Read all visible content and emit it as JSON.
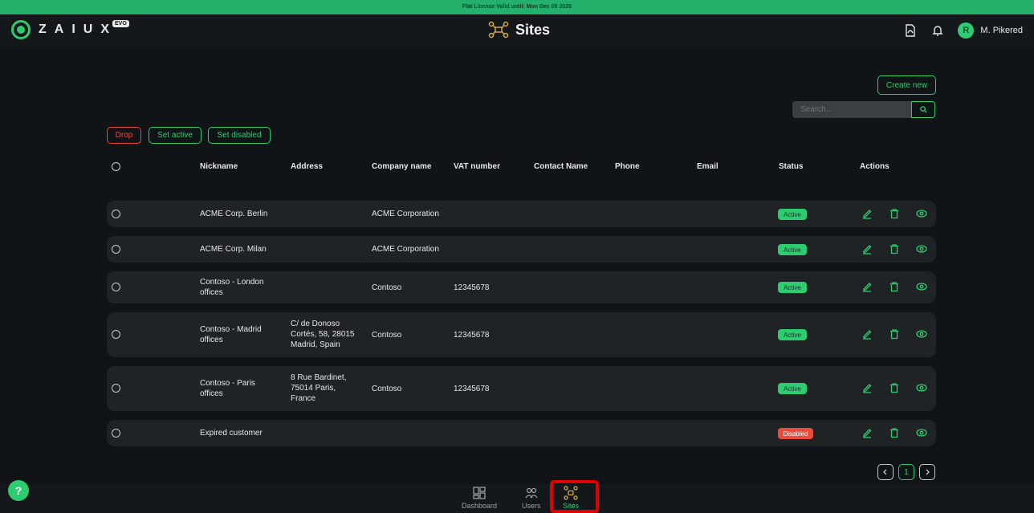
{
  "license": {
    "text": "Flat License   Valid until: Mon Dec 08 2025"
  },
  "app": {
    "logo_text": "ZAIUX",
    "logo_badge": "EVO",
    "page_title": "Sites"
  },
  "user": {
    "initial": "R",
    "name": "M. Pikered"
  },
  "toolbar": {
    "create_label": "Create new",
    "search_placeholder": "Search..."
  },
  "bulk_actions": {
    "drop": "Drop",
    "set_active": "Set active",
    "set_disabled": "Set disabled"
  },
  "columns": [
    "Nickname",
    "Address",
    "Company name",
    "VAT number",
    "Contact Name",
    "Phone",
    "Email",
    "Status",
    "Actions"
  ],
  "rows": [
    {
      "nickname": [
        "ACME Corp. Berlin"
      ],
      "address": [],
      "company": "ACME Corporation",
      "vat": "",
      "status": "Active"
    },
    {
      "nickname": [
        "ACME Corp. Milan"
      ],
      "address": [],
      "company": "ACME Corporation",
      "vat": "",
      "status": "Active"
    },
    {
      "nickname": [
        "Contoso - London",
        "offices"
      ],
      "address": [],
      "company": "Contoso",
      "vat": "12345678",
      "status": "Active"
    },
    {
      "nickname": [
        "Contoso - Madrid",
        "offices"
      ],
      "address": [
        "C/ de Donoso",
        "Cortés, 58, 28015",
        "Madrid, Spain"
      ],
      "company": "Contoso",
      "vat": "12345678",
      "status": "Active"
    },
    {
      "nickname": [
        "Contoso - Paris",
        "offices"
      ],
      "address": [
        "8 Rue Bardinet,",
        "75014 Paris,",
        "France"
      ],
      "company": "Contoso",
      "vat": "12345678",
      "status": "Active"
    },
    {
      "nickname": [
        "Expired customer"
      ],
      "address": [],
      "company": "",
      "vat": "",
      "status": "Disabled"
    }
  ],
  "pagination": {
    "current": "1"
  },
  "bottom_nav": [
    {
      "label": "Dashboard",
      "icon": "dashboard-icon"
    },
    {
      "label": "Users",
      "icon": "users-icon"
    },
    {
      "label": "Sites",
      "icon": "sites-icon",
      "selected": true
    }
  ],
  "help": {
    "label": "?"
  },
  "colors": {
    "accent": "#2ecc71",
    "danger": "#e74c3c",
    "background": "#111416",
    "row": "#1f2326"
  }
}
